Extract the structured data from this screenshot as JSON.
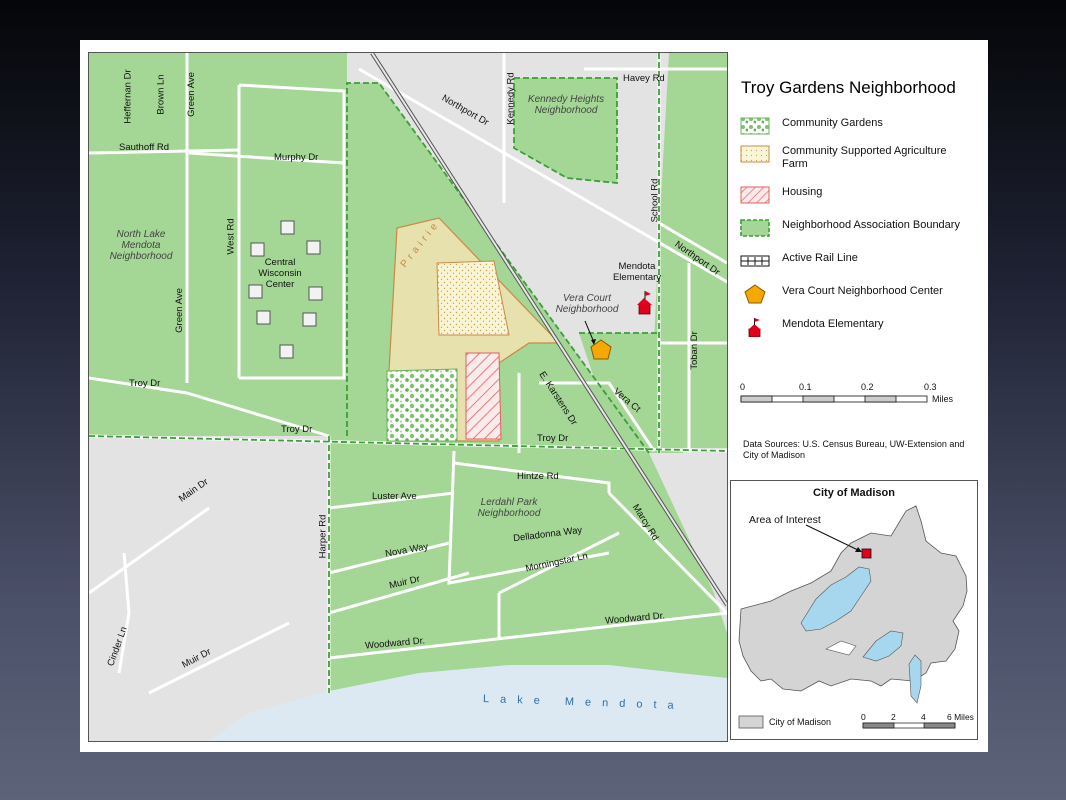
{
  "legend": {
    "title": "Troy Gardens Neighborhood",
    "items": [
      {
        "label": "Community Gardens",
        "icon": "community-gardens-swatch"
      },
      {
        "label": "Community Supported Agriculture Farm",
        "icon": "csa-farm-swatch"
      },
      {
        "label": "Housing",
        "icon": "housing-swatch"
      },
      {
        "label": "Neighborhood Association Boundary",
        "icon": "boundary-swatch"
      },
      {
        "label": "Active Rail Line",
        "icon": "rail-line-swatch"
      },
      {
        "label": "Vera Court Neighborhood Center",
        "icon": "pentagon-icon"
      },
      {
        "label": "Mendota Elementary",
        "icon": "school-flag-icon"
      }
    ]
  },
  "scale": {
    "ticks": [
      "0",
      "0.1",
      "0.2",
      "0.3"
    ],
    "unit": "Miles"
  },
  "sources": "Data Sources: U.S. Census Bureau, UW-Extension and City of Madison",
  "inset": {
    "title": "City of Madison",
    "area_label": "Area of Interest",
    "legend_label": "City of Madison",
    "scale_ticks": [
      "0",
      "2",
      "4",
      "6 Miles"
    ]
  },
  "map": {
    "neighborhoods": {
      "kennedy": "Kennedy Heights Neighborhood",
      "north_lake": "North Lake Mendota Neighborhood",
      "vera_court": "Vera Court Neighborhood",
      "lerdahl": "Lerdahl Park Neighborhood"
    },
    "places": {
      "central_wisconsin": "Central Wisconsin Center",
      "mendota_elementary": "Mendota Elementary",
      "prairie": "Prairie",
      "lake": "Lake Mendota"
    },
    "streets": {
      "heffernan": "Heffernan Dr",
      "brown": "Brown Ln",
      "green_ave_top": "Green Ave",
      "sauthoff": "Sauthoff Rd",
      "murphy": "Murphy Dr",
      "west": "West Rd",
      "green_ave": "Green Ave",
      "troy_left": "Troy Dr",
      "troy_mid": "Troy Dr",
      "troy_right": "Troy Dr",
      "havey": "Havey Rd",
      "northport_top": "Northport Dr",
      "kennedy": "Kennedy Rd",
      "school": "School Rd",
      "northport_right": "Northport Dr",
      "toban": "Toban Dr",
      "vera": "Vera Ct",
      "karstens": "E. Karstens Dr",
      "hintze": "Hintze Rd",
      "luster": "Luster Ave",
      "delladonna": "Delladonna Way",
      "nova": "Nova Way",
      "morningstar": "Morningstar Ln",
      "muir_top": "Muir Dr",
      "harper": "Harper Rd",
      "marcy": "Marcy Rd",
      "woodward_right": "Woodward Dr.",
      "woodward_left": "Woodward Dr.",
      "main": "Main Dr",
      "cinder": "Cinder Ln",
      "muir_left": "Muir Dr"
    }
  },
  "colors": {
    "neighborhood_green": "#a4d695",
    "non_neighborhood_gray": "#e3e3e3",
    "boundary_green": "#3aa035",
    "csa_farm": "#f6ebbd",
    "prairie_tan": "#e6e1ad",
    "housing_red": "#e06060",
    "lake_blue": "#dce9f3",
    "inset_lake": "#a6d7ef",
    "inset_city": "#d4d4d4",
    "center_orange": "#f5a800",
    "school_red": "#e0001b"
  }
}
